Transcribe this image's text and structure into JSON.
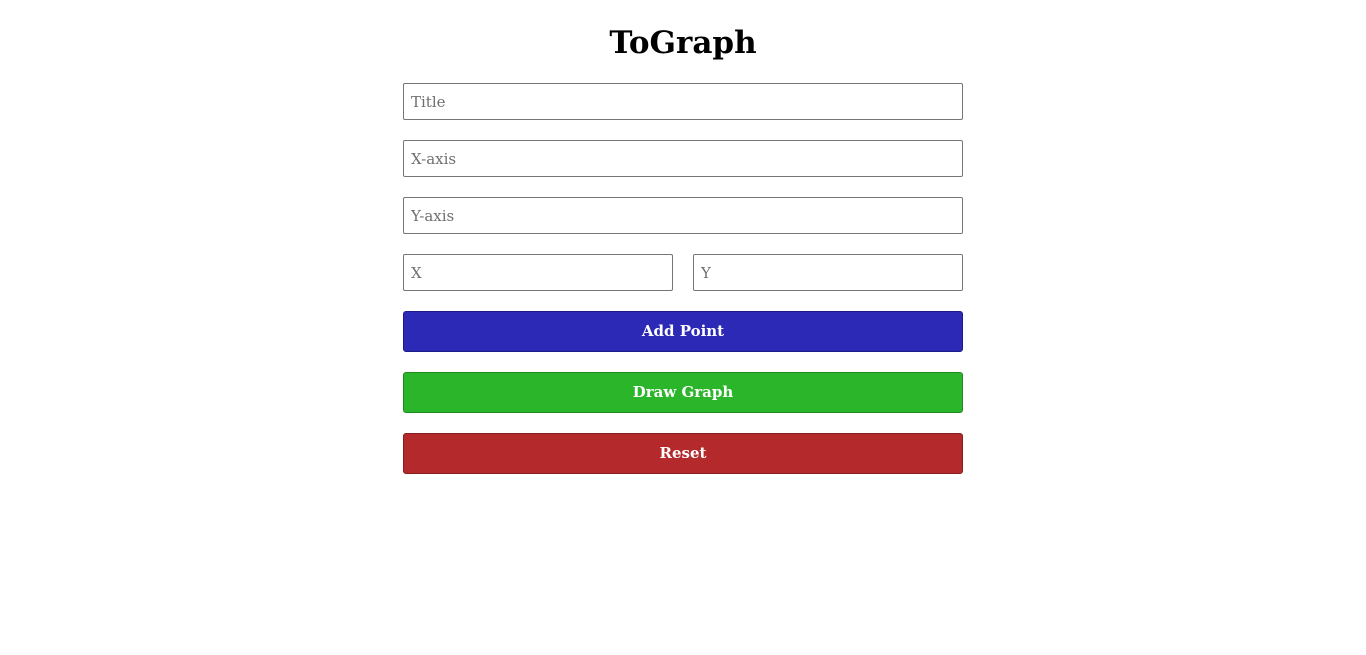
{
  "header": {
    "title": "ToGraph"
  },
  "form": {
    "title_placeholder": "Title",
    "xaxis_placeholder": "X-axis",
    "yaxis_placeholder": "Y-axis",
    "x_placeholder": "X",
    "y_placeholder": "Y"
  },
  "buttons": {
    "add_point": "Add Point",
    "draw_graph": "Draw Graph",
    "reset": "Reset"
  },
  "colors": {
    "add_point": "#2b29b5",
    "draw_graph": "#2bb52b",
    "reset": "#b3292c"
  }
}
